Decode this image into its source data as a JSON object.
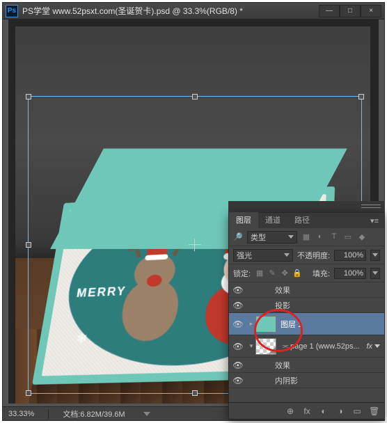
{
  "title": "PS学堂  www.52psxt.com(圣诞贺卡).psd @ 33.3%(RGB/8) *",
  "ps_icon_label": "Ps",
  "win": {
    "min": "—",
    "max": "□",
    "close": "×"
  },
  "status": {
    "zoom": "33.33%",
    "doc_label": "文档:",
    "doc_info": "6.82M/39.6M"
  },
  "card_text": "MERRY",
  "panel": {
    "tabs": [
      "图层",
      "通道",
      "路径"
    ],
    "kind_label": "类型",
    "filter_icons": [
      "▦",
      "◐",
      "T",
      "▭",
      "◆"
    ],
    "blend_mode": "强光",
    "opacity_label": "不透明度:",
    "opacity_value": "100%",
    "lock_label": "锁定:",
    "lock_icons": [
      "▦",
      "✎",
      "✥",
      "🔒"
    ],
    "fill_label": "填充:",
    "fill_value": "100%",
    "footer_icons": [
      "⊕",
      "fx",
      "◐",
      "◑",
      "▭",
      "🗑"
    ]
  },
  "layers": {
    "fx_label": "fx",
    "items": [
      {
        "type": "fx",
        "name": "效果",
        "eye": "👁"
      },
      {
        "type": "fx",
        "name": "投影",
        "eye": "👁"
      },
      {
        "type": "layer",
        "name": "图层 1",
        "eye": "👁",
        "selected": true,
        "thumb": "teal"
      },
      {
        "type": "layer",
        "name": "page 1 (www.52ps...",
        "eye": "👁",
        "thumb": "page",
        "chain": true,
        "fx": true
      },
      {
        "type": "fx",
        "name": "效果",
        "eye": "👁"
      },
      {
        "type": "fx",
        "name": "内阴影",
        "eye": "👁"
      }
    ]
  }
}
